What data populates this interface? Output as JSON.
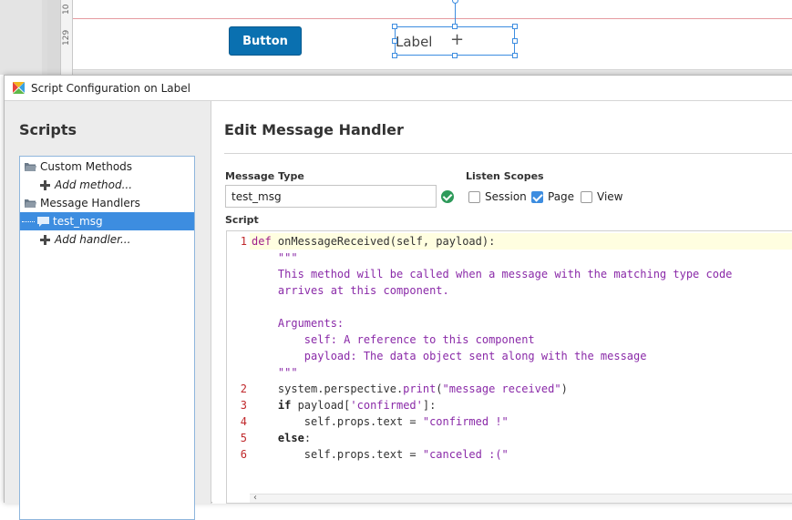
{
  "designer": {
    "ruler_marks": [
      "10",
      "129"
    ],
    "button_label": "Button",
    "label_text": "Label"
  },
  "dialog": {
    "title": "Script Configuration on Label"
  },
  "sidebar": {
    "heading": "Scripts",
    "tree": [
      {
        "label": "Custom Methods",
        "type": "folder"
      },
      {
        "label": "Add method...",
        "type": "add"
      },
      {
        "label": "Message Handlers",
        "type": "folder"
      },
      {
        "label": "test_msg",
        "type": "handler",
        "selected": true
      },
      {
        "label": "Add handler...",
        "type": "add"
      }
    ]
  },
  "main": {
    "heading": "Edit Message Handler",
    "message_type_label": "Message Type",
    "message_type_value": "test_msg",
    "listen_scopes_label": "Listen Scopes",
    "scopes": [
      {
        "label": "Session",
        "checked": false
      },
      {
        "label": "Page",
        "checked": true
      },
      {
        "label": "View",
        "checked": false
      }
    ],
    "script_label": "Script"
  },
  "code": {
    "line_numbers": [
      "1",
      "2",
      "3",
      "4",
      "5",
      "6"
    ],
    "lines": [
      "def onMessageReceived(self, payload):",
      "    \"\"\"",
      "    This method will be called when a message with the matching type code",
      "    arrives at this component.",
      "",
      "    Arguments:",
      "        self: A reference to this component",
      "        payload: The data object sent along with the message",
      "    \"\"\"",
      "    system.perspective.print(\"message received\")",
      "    if payload['confirmed']:",
      "        self.props.text = \"confirmed !\"",
      "    else:",
      "        self.props.text = \"canceled :(\""
    ]
  },
  "colors": {
    "accent": "#3d8de0",
    "button": "#0a70b0",
    "success": "#2e9a5a",
    "line_number": "#c0282b"
  }
}
